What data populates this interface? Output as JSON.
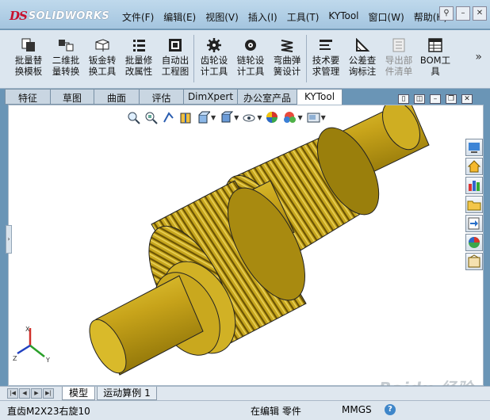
{
  "app": {
    "logo_ds": "DS",
    "logo_text": "SOLIDWORKS"
  },
  "menubar": {
    "items": [
      {
        "label": "文件(F)"
      },
      {
        "label": "编辑(E)"
      },
      {
        "label": "视图(V)"
      },
      {
        "label": "插入(I)"
      },
      {
        "label": "工具(T)"
      },
      {
        "label": "KYTool"
      },
      {
        "label": "窗口(W)"
      },
      {
        "label": "帮助(H)"
      }
    ]
  },
  "toolbar": {
    "tools": [
      {
        "line1": "批量替",
        "line2": "换模板",
        "icon": "batch-replace-icon",
        "enabled": true
      },
      {
        "line1": "二维批",
        "line2": "量转换",
        "icon": "2d-batch-convert-icon",
        "enabled": true
      },
      {
        "line1": "钣金转",
        "line2": "换工具",
        "icon": "sheetmetal-convert-icon",
        "enabled": true
      },
      {
        "line1": "批量修",
        "line2": "改属性",
        "icon": "batch-properties-icon",
        "enabled": true
      },
      {
        "line1": "自动出",
        "line2": "工程图",
        "icon": "auto-drawing-icon",
        "enabled": true
      },
      {
        "line1": "齿轮设",
        "line2": "计工具",
        "icon": "gear-design-icon",
        "enabled": true
      },
      {
        "line1": "链轮设",
        "line2": "计工具",
        "icon": "sprocket-design-icon",
        "enabled": true
      },
      {
        "line1": "弯曲弹",
        "line2": "簧设计",
        "icon": "spring-design-icon",
        "enabled": true
      },
      {
        "line1": "技术要",
        "line2": "求管理",
        "icon": "tech-requirements-icon",
        "enabled": true
      },
      {
        "line1": "公差查",
        "line2": "询标注",
        "icon": "tolerance-icon",
        "enabled": true
      },
      {
        "line1": "导出部",
        "line2": "件清单",
        "icon": "export-parts-list-icon",
        "enabled": false
      },
      {
        "line1": "BOM工",
        "line2": "具",
        "icon": "bom-tool-icon",
        "enabled": true
      }
    ],
    "more": "»"
  },
  "tabs": [
    {
      "label": "特征",
      "active": false
    },
    {
      "label": "草图",
      "active": false
    },
    {
      "label": "曲面",
      "active": false
    },
    {
      "label": "评估",
      "active": false
    },
    {
      "label": "DimXpert",
      "active": false
    },
    {
      "label": "办公室产品",
      "active": false
    },
    {
      "label": "KYTool",
      "active": true
    }
  ],
  "triad": {
    "x": "X",
    "y": "Y",
    "z": "Z"
  },
  "sheet_tabs": [
    {
      "label": "模型",
      "active": true
    },
    {
      "label": "运动算例 1",
      "active": false
    }
  ],
  "status": {
    "left": "直齿M2X23右旋10",
    "mid": "在编辑 零件",
    "units": "MMGS",
    "help": "?"
  },
  "watermark": "Baidu 经验",
  "colors": {
    "gold": "#c9a81e",
    "title_bg": "#a4c5df",
    "cmd_bg": "#dce6ef"
  }
}
